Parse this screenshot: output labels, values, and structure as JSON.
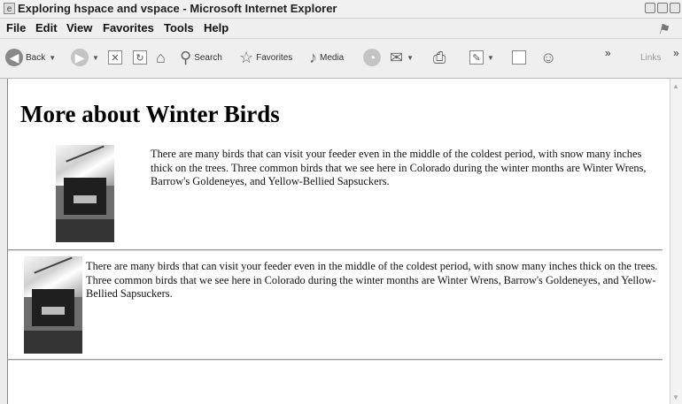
{
  "window": {
    "title": "Exploring hspace and vspace - Microsoft Internet Explorer",
    "icons": {
      "app": "ie-page-icon",
      "minimize": "minimize-icon",
      "maximize": "maximize-icon",
      "close": "close-icon"
    }
  },
  "menu": {
    "items": [
      "File",
      "Edit",
      "View",
      "Favorites",
      "Tools",
      "Help"
    ]
  },
  "toolbar": {
    "back_label": "Back",
    "search_label": "Search",
    "favorites_label": "Favorites",
    "media_label": "Media",
    "chevron": "»",
    "links_label": "Links"
  },
  "page": {
    "heading": "More about Winter Birds",
    "paragraph1": "There are many birds that can visit your feeder even in the middle of the coldest period, with snow many inches thick on the trees. Three common birds that we see here in Colorado during the winter months are Winter Wrens, Barrow's Goldeneyes, and Yellow-Bellied Sapsuckers.",
    "paragraph2": "There are many birds that can visit your feeder even in the middle of the coldest period, with snow many inches thick on the trees. Three common birds that we see here in Colorado during the winter months are Winter Wrens, Barrow's Goldeneyes, and Yellow-Bellied Sapsuckers."
  },
  "colors": {
    "window_bg": "#ececec",
    "page_bg": "#ffffff",
    "text": "#111111"
  }
}
